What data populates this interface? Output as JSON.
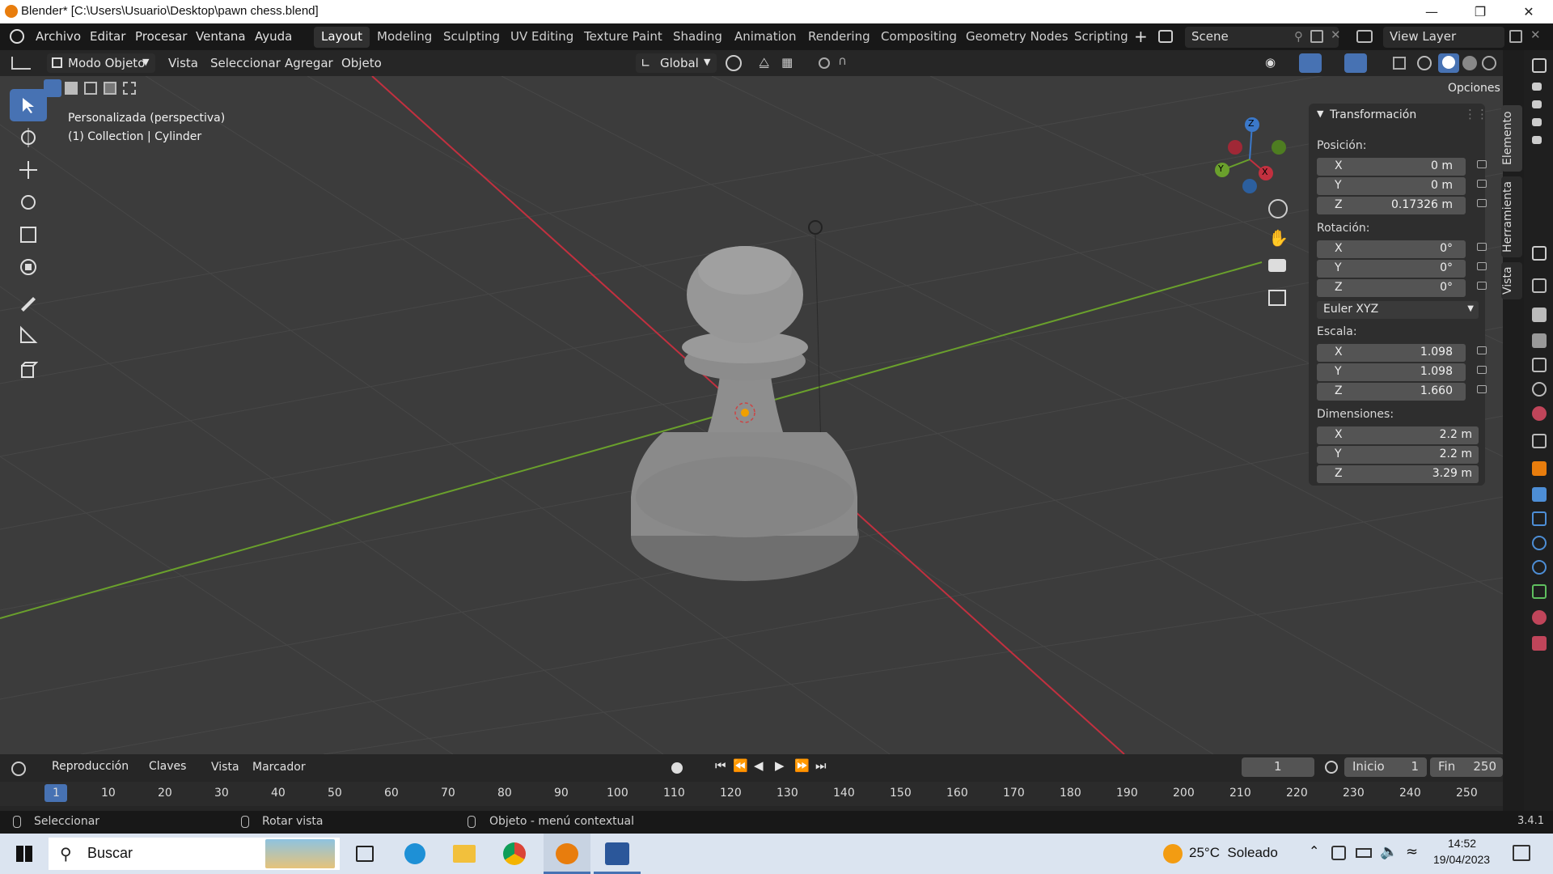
{
  "window": {
    "title": "Blender* [C:\\Users\\Usuario\\Desktop\\pawn chess.blend]"
  },
  "menu": [
    "Archivo",
    "Editar",
    "Procesar",
    "Ventana",
    "Ayuda"
  ],
  "workspaces": [
    "Layout",
    "Modeling",
    "Sculpting",
    "UV Editing",
    "Texture Paint",
    "Shading",
    "Animation",
    "Rendering",
    "Compositing",
    "Geometry Nodes",
    "Scripting"
  ],
  "scene": {
    "name": "Scene",
    "view_layer": "View Layer"
  },
  "header": {
    "mode": "Modo Objeto",
    "items": [
      "Vista",
      "Seleccionar",
      "Agregar",
      "Objeto"
    ],
    "orientation": "Global",
    "options": "Opciones"
  },
  "viewport": {
    "view_name": "Personalizada (perspectiva)",
    "object_info": "(1) Collection | Cylinder",
    "gizmo": {
      "x": "X",
      "y": "Y",
      "z": "Z"
    }
  },
  "npanel": {
    "title": "Transformación",
    "position_label": "Posición:",
    "position": [
      {
        "axis": "X",
        "value": "0 m"
      },
      {
        "axis": "Y",
        "value": "0 m"
      },
      {
        "axis": "Z",
        "value": "0.17326 m"
      }
    ],
    "rotation_label": "Rotación:",
    "rotation": [
      {
        "axis": "X",
        "value": "0°"
      },
      {
        "axis": "Y",
        "value": "0°"
      },
      {
        "axis": "Z",
        "value": "0°"
      }
    ],
    "rotation_mode": "Euler XYZ",
    "scale_label": "Escala:",
    "scale": [
      {
        "axis": "X",
        "value": "1.098"
      },
      {
        "axis": "Y",
        "value": "1.098"
      },
      {
        "axis": "Z",
        "value": "1.660"
      }
    ],
    "dimensions_label": "Dimensiones:",
    "dimensions": [
      {
        "axis": "X",
        "value": "2.2 m"
      },
      {
        "axis": "Y",
        "value": "2.2 m"
      },
      {
        "axis": "Z",
        "value": "3.29 m"
      }
    ],
    "tabs": [
      "Elemento",
      "Herramienta",
      "Vista"
    ]
  },
  "timeline": {
    "menus": [
      "Reproducción",
      "Claves",
      "Vista",
      "Marcador"
    ],
    "current_frame": "1",
    "start_label": "Inicio",
    "start": "1",
    "end_label": "Fin",
    "end": "250",
    "ruler": [
      "1",
      "10",
      "20",
      "30",
      "40",
      "50",
      "60",
      "70",
      "80",
      "90",
      "100",
      "110",
      "120",
      "130",
      "140",
      "150",
      "160",
      "170",
      "180",
      "190",
      "200",
      "210",
      "220",
      "230",
      "240",
      "250"
    ]
  },
  "status": {
    "select": "Seleccionar",
    "rotate": "Rotar vista",
    "context": "Objeto - menú contextual",
    "version": "3.4.1"
  },
  "taskbar": {
    "search": "Buscar",
    "weather": "25°C  Soleado",
    "time": "14:52",
    "date": "19/04/2023"
  },
  "colors": {
    "accent": "#4772b3",
    "x_axis": "#c2303f",
    "y_axis": "#6aa02c",
    "z_axis": "#3b78c9"
  }
}
